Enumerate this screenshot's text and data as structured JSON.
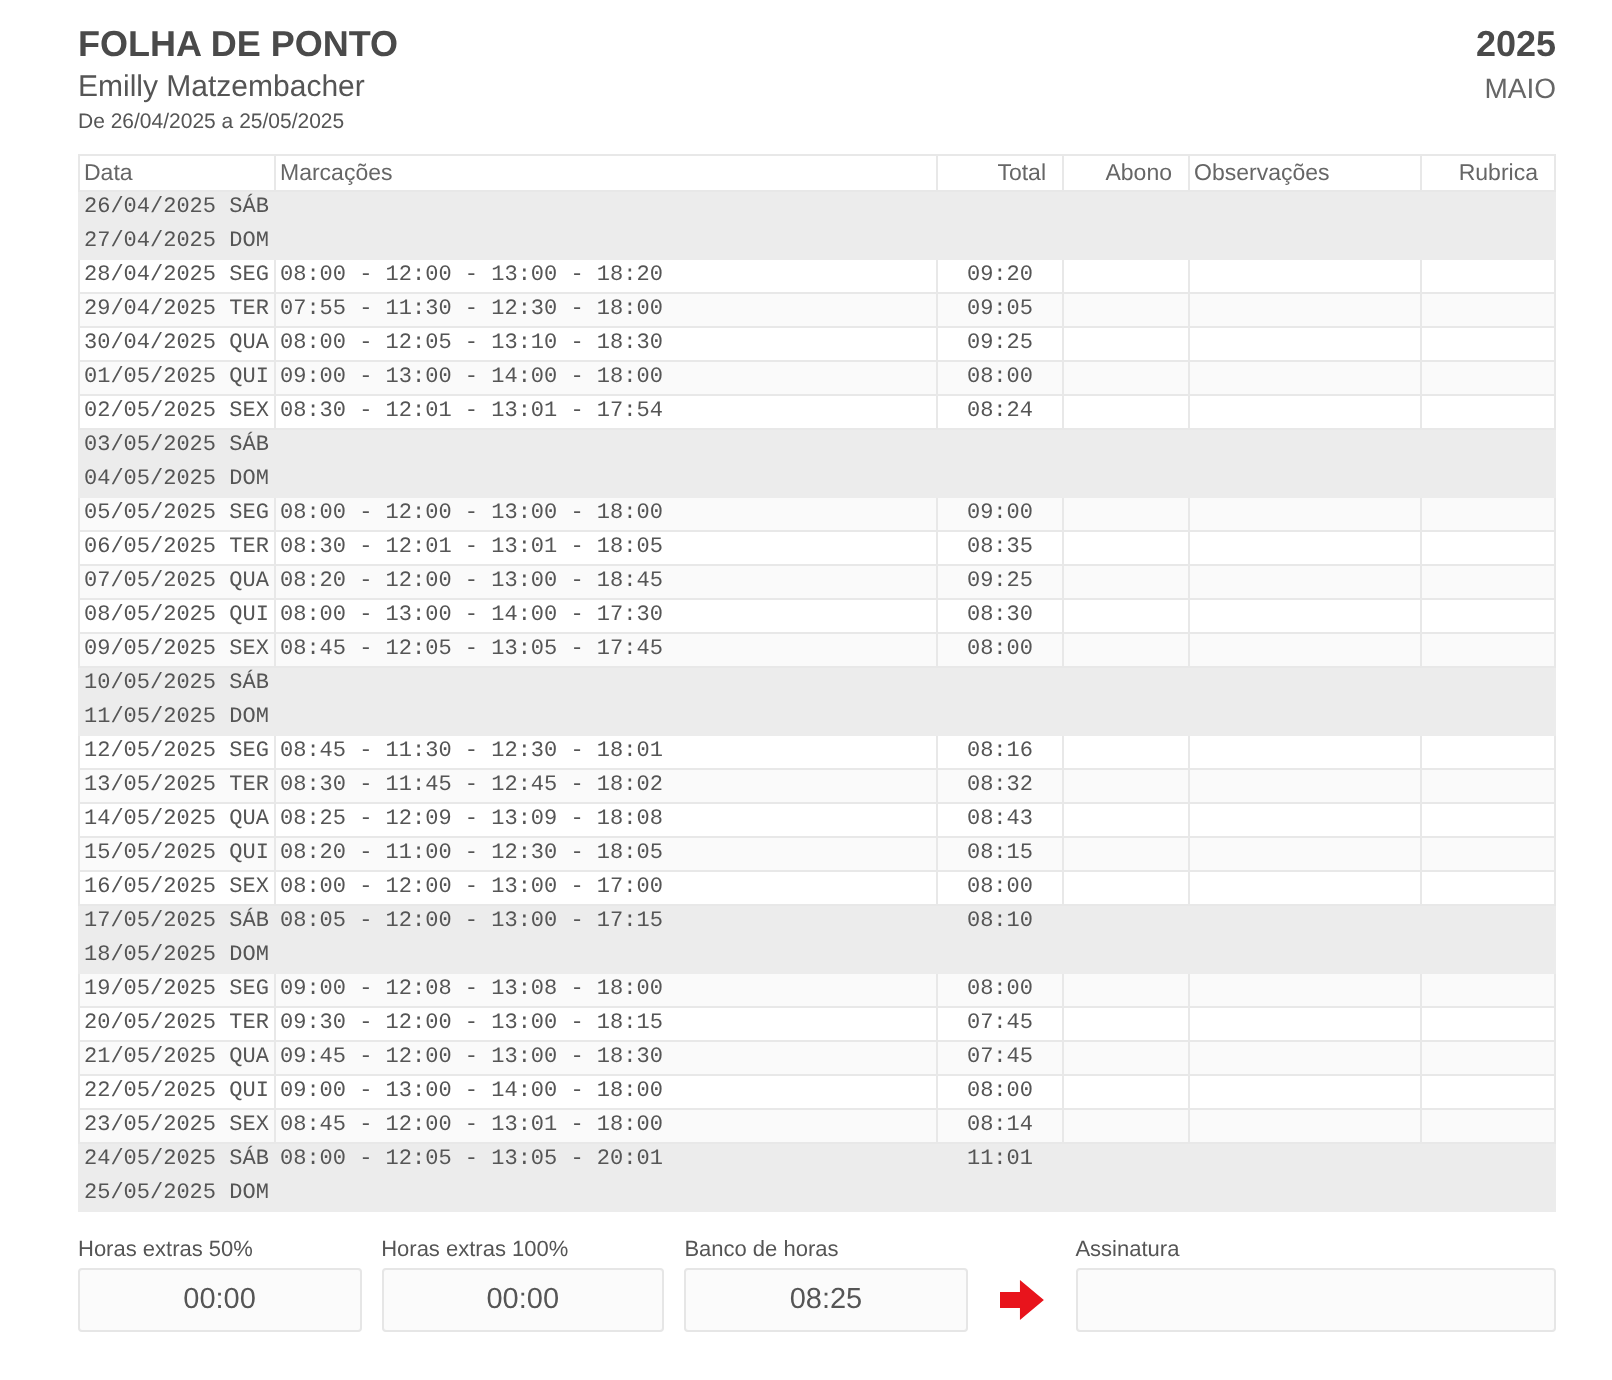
{
  "header": {
    "title": "FOLHA DE PONTO",
    "employee": "Emilly Matzembacher",
    "period": "De 26/04/2025 a 25/05/2025",
    "year": "2025",
    "month": "MAIO"
  },
  "table": {
    "columns": [
      "Data",
      "Marcações",
      "Total",
      "Abono",
      "Observações",
      "Rubrica"
    ],
    "rows": [
      {
        "kind": "weekend",
        "date": "26/04/2025 SÁB"
      },
      {
        "kind": "weekend",
        "date": "27/04/2025 DOM"
      },
      {
        "kind": "weekday",
        "date": "28/04/2025 SEG",
        "marks": "08:00 - 12:00 - 13:00 - 18:20",
        "total": "09:20"
      },
      {
        "kind": "weekday",
        "date": "29/04/2025 TER",
        "marks": "07:55 - 11:30 - 12:30 - 18:00",
        "total": "09:05"
      },
      {
        "kind": "weekday",
        "date": "30/04/2025 QUA",
        "marks": "08:00 - 12:05 - 13:10 - 18:30",
        "total": "09:25"
      },
      {
        "kind": "weekday",
        "date": "01/05/2025 QUI",
        "marks": "09:00 - 13:00 - 14:00 - 18:00",
        "total": "08:00"
      },
      {
        "kind": "weekday",
        "date": "02/05/2025 SEX",
        "marks": "08:30 - 12:01 - 13:01 - 17:54",
        "total": "08:24"
      },
      {
        "kind": "weekend",
        "date": "03/05/2025 SÁB"
      },
      {
        "kind": "weekend",
        "date": "04/05/2025 DOM"
      },
      {
        "kind": "weekday",
        "date": "05/05/2025 SEG",
        "marks": "08:00 - 12:00 - 13:00 - 18:00",
        "total": "09:00"
      },
      {
        "kind": "weekday",
        "date": "06/05/2025 TER",
        "marks": "08:30 - 12:01 - 13:01 - 18:05",
        "total": "08:35"
      },
      {
        "kind": "weekday",
        "date": "07/05/2025 QUA",
        "marks": "08:20 - 12:00 - 13:00 - 18:45",
        "total": "09:25"
      },
      {
        "kind": "weekday",
        "date": "08/05/2025 QUI",
        "marks": "08:00 - 13:00 - 14:00 - 17:30",
        "total": "08:30"
      },
      {
        "kind": "weekday",
        "date": "09/05/2025 SEX",
        "marks": "08:45 - 12:05 - 13:05 - 17:45",
        "total": "08:00"
      },
      {
        "kind": "weekend",
        "date": "10/05/2025 SÁB"
      },
      {
        "kind": "weekend",
        "date": "11/05/2025 DOM"
      },
      {
        "kind": "weekday",
        "date": "12/05/2025 SEG",
        "marks": "08:45 - 11:30 - 12:30 - 18:01",
        "total": "08:16"
      },
      {
        "kind": "weekday",
        "date": "13/05/2025 TER",
        "marks": "08:30 - 11:45 - 12:45 - 18:02",
        "total": "08:32"
      },
      {
        "kind": "weekday",
        "date": "14/05/2025 QUA",
        "marks": "08:25 - 12:09 - 13:09 - 18:08",
        "total": "08:43"
      },
      {
        "kind": "weekday",
        "date": "15/05/2025 QUI",
        "marks": "08:20 - 11:00 - 12:30 - 18:05",
        "total": "08:15"
      },
      {
        "kind": "weekday",
        "date": "16/05/2025 SEX",
        "marks": "08:00 - 12:00 - 13:00 - 17:00",
        "total": "08:00"
      },
      {
        "kind": "weekend",
        "date": "17/05/2025 SÁB",
        "marks": "08:05 - 12:00 - 13:00 - 17:15",
        "total": "08:10"
      },
      {
        "kind": "weekend",
        "date": "18/05/2025 DOM"
      },
      {
        "kind": "weekday",
        "date": "19/05/2025 SEG",
        "marks": "09:00 - 12:08 - 13:08 - 18:00",
        "total": "08:00"
      },
      {
        "kind": "weekday",
        "date": "20/05/2025 TER",
        "marks": "09:30 - 12:00 - 13:00 - 18:15",
        "total": "07:45"
      },
      {
        "kind": "weekday",
        "date": "21/05/2025 QUA",
        "marks": "09:45 - 12:00 - 13:00 - 18:30",
        "total": "07:45"
      },
      {
        "kind": "weekday",
        "date": "22/05/2025 QUI",
        "marks": "09:00 - 13:00 - 14:00 - 18:00",
        "total": "08:00"
      },
      {
        "kind": "weekday",
        "date": "23/05/2025 SEX",
        "marks": "08:45 - 12:00 - 13:01 - 18:00",
        "total": "08:14"
      },
      {
        "kind": "weekend",
        "date": "24/05/2025 SÁB",
        "marks": "08:00 - 12:05 - 13:05 - 20:01",
        "total": "11:01"
      },
      {
        "kind": "weekend",
        "date": "25/05/2025 DOM"
      }
    ]
  },
  "summary": [
    {
      "label": "Horas extras 50%",
      "value": "00:00"
    },
    {
      "label": "Horas extras 100%",
      "value": "00:00"
    },
    {
      "label": "Banco de horas",
      "value": "08:25"
    }
  ],
  "signature": {
    "label": "Assinatura"
  }
}
